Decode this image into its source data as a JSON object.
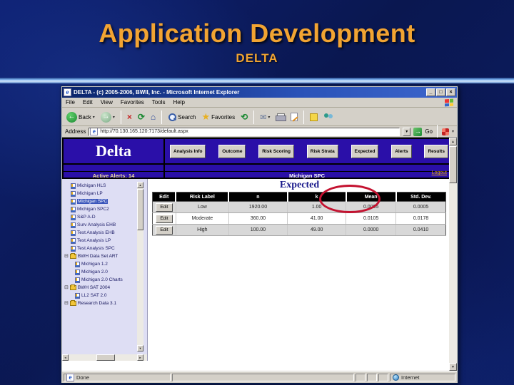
{
  "slide": {
    "title": "Application Development",
    "subtitle": "DELTA",
    "accent_color": "#F2A432",
    "background_color": "#0A1750"
  },
  "browser": {
    "window_title": "DELTA - (c) 2005-2006, BWII, Inc. - Microsoft Internet Explorer",
    "menu": [
      "File",
      "Edit",
      "View",
      "Favorites",
      "Tools",
      "Help"
    ],
    "toolbar": {
      "back_label": "Back",
      "search_label": "Search",
      "favorites_label": "Favorites"
    },
    "address": {
      "label": "Address",
      "url": "http://70.130.165.120:7173/default.aspx",
      "go_label": "Go"
    },
    "status": {
      "left": "Done",
      "right": "Internet"
    }
  },
  "icons": {
    "minimize": "_",
    "maximize": "□",
    "close": "×",
    "back_arrow": "←",
    "forward_arrow": "→",
    "stop": "×",
    "refresh": "⟳",
    "home": "⌂",
    "history": "⟲",
    "star": "★",
    "mail": "✉",
    "dropdown": "▾",
    "go_arrow": "→",
    "up": "▲",
    "down": "▼",
    "left": "◄",
    "right": "►",
    "expander_open": "⊟"
  },
  "app": {
    "logo": "Delta",
    "nav": [
      "Analysis Info",
      "Outcome",
      "Risk Scoring",
      "Risk Strata",
      "Expected",
      "Alerts",
      "Results"
    ],
    "circled_nav": "Expected",
    "annotation_color": "#C41230",
    "logout_label": "Logout",
    "active_alerts": "Active Alerts: 14",
    "context_title": "Michigan SPC",
    "page_title": "Expected",
    "sidebar_items": [
      {
        "label": "Michigan HLS",
        "type": "leaf"
      },
      {
        "label": "Michigan LP",
        "type": "leaf"
      },
      {
        "label": "Michigan SPC",
        "type": "leaf",
        "selected": true
      },
      {
        "label": "Michigan SPC2",
        "type": "leaf"
      },
      {
        "label": "S&P A-D",
        "type": "leaf"
      },
      {
        "label": "Surv Analysis EHB",
        "type": "leaf"
      },
      {
        "label": "Test Analysis EHB",
        "type": "leaf"
      },
      {
        "label": "Test Analysis LP",
        "type": "leaf"
      },
      {
        "label": "Test Analysis SPC",
        "type": "leaf"
      },
      {
        "label": "BWH Data Set ART",
        "type": "folder"
      },
      {
        "label": "Michigan 1.2",
        "type": "leaf"
      },
      {
        "label": "Michigan 2.0",
        "type": "leaf"
      },
      {
        "label": "Michigan 2.0 Charts",
        "type": "leaf"
      },
      {
        "label": "BWH SAT 2004",
        "type": "folder"
      },
      {
        "label": "LL2 SAT 2.0",
        "type": "leaf"
      },
      {
        "label": "Research Data 3.1",
        "type": "folder"
      }
    ],
    "table": {
      "columns": [
        "Edit",
        "Risk Label",
        "n",
        "k",
        "Mean",
        "Std. Dev."
      ],
      "edit_label": "Edit",
      "rows": [
        {
          "risk_label": "Low",
          "n": "1920.00",
          "k": "1.00",
          "mean": "0.0005",
          "std_dev": "0.0005"
        },
        {
          "risk_label": "Moderate",
          "n": "360.00",
          "k": "41.00",
          "mean": "0.0105",
          "std_dev": "0.0178"
        },
        {
          "risk_label": "High",
          "n": "100.00",
          "k": "49.00",
          "mean": "0.0000",
          "std_dev": "0.0410"
        }
      ]
    }
  }
}
